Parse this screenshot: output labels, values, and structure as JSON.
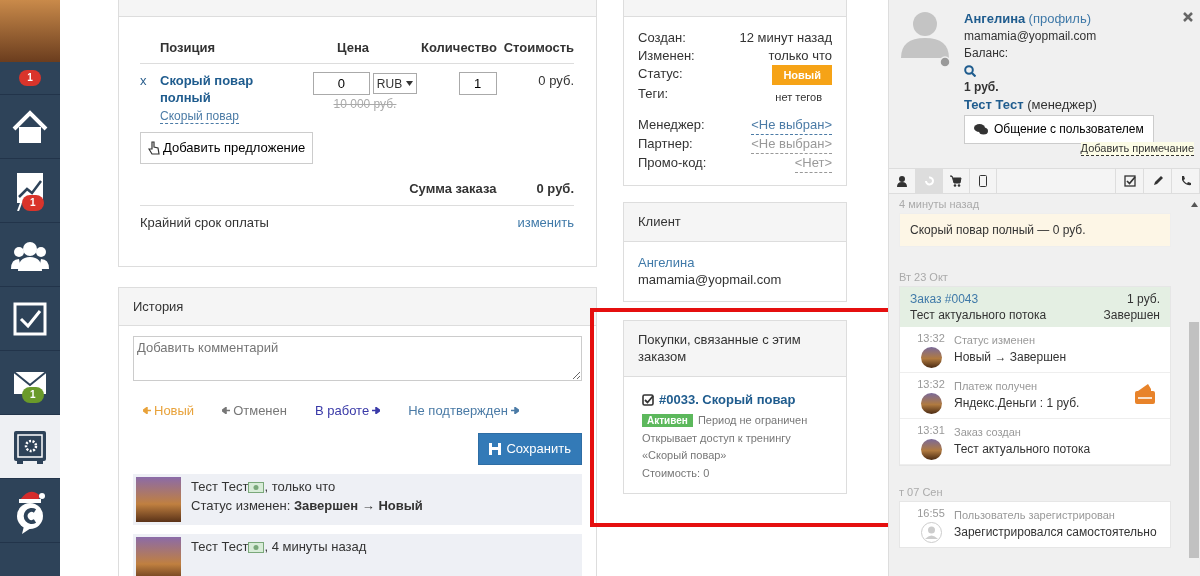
{
  "sidebar": {
    "badge": {
      "text": "1",
      "color": "#d9342b"
    },
    "items": [
      {
        "kind": "home",
        "selected": false
      },
      {
        "kind": "chart",
        "selected": false,
        "badge": "1",
        "color": "#d9342b"
      },
      {
        "kind": "people",
        "selected": false
      },
      {
        "kind": "tasks",
        "selected": false
      },
      {
        "kind": "mail",
        "selected": false,
        "badge": "1",
        "color": "#6a9a2a"
      },
      {
        "kind": "safe",
        "selected": true
      },
      {
        "kind": "logo",
        "selected": false
      }
    ]
  },
  "order": {
    "columns": [
      "Позиция",
      "Цена",
      "Количество",
      "Стоимость"
    ],
    "rows": [
      {
        "remove": "x",
        "name": "Скорый повар полный",
        "offer": "Скорый повар",
        "price": "0",
        "currency": "RUB",
        "old_price": "10 000 руб.",
        "quantity": "1",
        "cost": "0 руб."
      }
    ],
    "add_offer_button": "Добавить предложение",
    "total_label": "Сумма заказа",
    "total": "0 руб.",
    "deadline_label": "Крайний срок оплаты",
    "deadline_action": "изменить"
  },
  "history": {
    "title": "История",
    "comment": {
      "placeholder": "Добавить комментарий"
    },
    "status_actions": [
      {
        "label": "Новый",
        "kind": "back",
        "color": "#e8a23a"
      },
      {
        "label": "Отменен",
        "kind": "back",
        "color": "#777777"
      },
      {
        "label": "В работе",
        "kind": "forward",
        "color": "#3a3aa8"
      },
      {
        "label": "Не подтвержден",
        "kind": "forward",
        "color": "#4b7ba6"
      }
    ],
    "save_button": "Сохранить",
    "entries": [
      {
        "author": "Тест Тест",
        "time": ", только что",
        "text": "Статус изменен: **Завершен → Новый**"
      },
      {
        "author": "Тест Тест",
        "time": ", 4 минуты назад"
      }
    ]
  },
  "status": {
    "rows": [
      {
        "kind": "text",
        "label": "Создан:",
        "value": "12 минут назад"
      },
      {
        "kind": "text",
        "label": "Изменен:",
        "value": "только что"
      },
      {
        "kind": "badge",
        "label": "Статус:",
        "value": "Новый"
      },
      {
        "kind": "tags",
        "label": "Теги:",
        "value": "нет тегов"
      },
      {
        "kind": "link",
        "label": "Менеджер:",
        "value": "<Не выбран>"
      },
      {
        "kind": "muted-link",
        "label": "Партнер:",
        "value": "<Не выбран>"
      },
      {
        "kind": "muted-link",
        "label": "Промо-код:",
        "value": "<Нет>"
      }
    ]
  },
  "client": {
    "title": "Клиент",
    "name": "Ангелина",
    "email": "mamamia@yopmail.com"
  },
  "purchases": {
    "title": "Покупки, связанные с этим заказом",
    "items": [
      {
        "title": "#0033. Скорый повар",
        "status": "Активен",
        "period": "Период не ограничен",
        "description": "Открывает доступ к тренингу «Скорый повар»",
        "cost": "Стоимость: 0"
      }
    ]
  },
  "user_panel": {
    "name": "Ангелина",
    "profile_link": "(профиль)",
    "email": "mamamia@yopmail.com",
    "balance_label": "Баланс:",
    "balance": "1 руб.",
    "manager": "Тест Тест",
    "manager_role": "(менеджер)",
    "chat_button": "Общение с пользователем",
    "add_note": "Добавить примечание",
    "tabs": [
      {
        "selected": false
      },
      {
        "selected": true
      },
      {
        "selected": false
      },
      {
        "selected": false
      }
    ],
    "feed": [
      {
        "date": "4 минуты назад",
        "cards": [
          {
            "kind": "note",
            "text": "Скорый повар полный — 0 руб."
          }
        ]
      },
      {
        "date": "Вт 23 Окт",
        "cards": [
          {
            "kind": "order",
            "title": "Заказ #0043",
            "amount": "1 руб.",
            "subtitle": "Тест актуального потока",
            "status": "Завершен",
            "events": [
              {
                "time": "13:32",
                "title": "Статус изменен",
                "text": "Новый → Завершен",
                "kind": "staff"
              },
              {
                "time": "13:32",
                "title": "Платеж получен",
                "text": "Яндекс.Деньги : 1 руб.",
                "kind": "payment"
              },
              {
                "time": "13:31",
                "title": "Заказ создан",
                "text": "Тест актуального потока",
                "kind": "staff"
              }
            ]
          }
        ]
      },
      {
        "date": "т 07 Сен",
        "cards": [
          {
            "kind": "events",
            "events": [
              {
                "time": "16:55",
                "title": "Пользователь зарегистрирован",
                "text": "Зарегистрировался самостоятельно",
                "kind": "user"
              }
            ]
          }
        ]
      }
    ]
  },
  "highlight": {
    "shown": true
  }
}
